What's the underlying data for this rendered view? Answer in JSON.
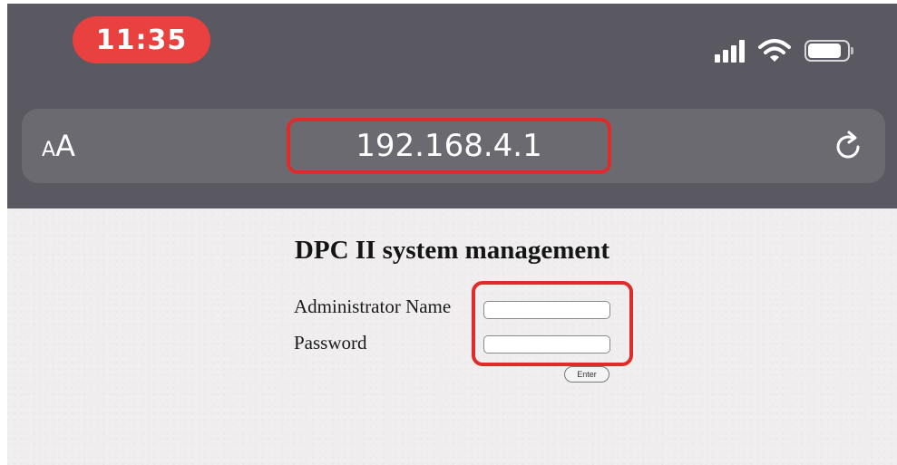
{
  "status_bar": {
    "time": "11:35"
  },
  "browser": {
    "text_size_small": "A",
    "text_size_large": "A",
    "url": "192.168.4.1",
    "icons": {
      "reload": "reload-icon",
      "signal": "cellular-signal-icon",
      "wifi": "wifi-icon",
      "battery": "battery-icon"
    }
  },
  "page": {
    "title": "DPC II system management",
    "admin_label": "Administrator Name",
    "admin_value": "",
    "password_label": "Password",
    "password_value": "",
    "enter_button": "Enter"
  },
  "colors": {
    "chrome": "#5a5860",
    "address_bar": "#6c6a71",
    "time_pill": "#e8413f",
    "highlight": "#e02b2b",
    "page_bg": "#f0eeef"
  }
}
